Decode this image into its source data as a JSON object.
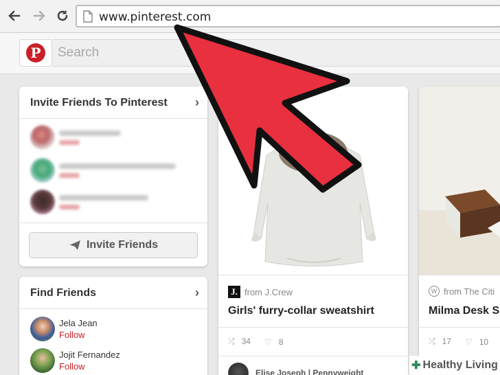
{
  "browser": {
    "url": "www.pinterest.com",
    "back_icon": "arrow-left-icon",
    "forward_icon": "arrow-right-icon",
    "reload_icon": "reload-icon"
  },
  "header": {
    "logo": "P",
    "search_placeholder": "Search"
  },
  "invite_card": {
    "title": "Invite Friends To Pinterest",
    "button_label": "Invite Friends"
  },
  "find_friends": {
    "title": "Find Friends",
    "friends": [
      {
        "name": "Jela Jean",
        "follow": "Follow"
      },
      {
        "name": "Jojit Fernandez",
        "follow": "Follow"
      }
    ]
  },
  "pins": [
    {
      "source_logo": "J.",
      "source": "from J.Crew",
      "title": "Girls' furry-collar sweatshirt",
      "repins": "34",
      "likes": "8",
      "pinner": "Elise Joseph | Pennyweight"
    },
    {
      "source": "from The Citi",
      "title": "Milma Desk S",
      "repins": "17",
      "likes": "10"
    }
  ],
  "watermark": "Healthy Living",
  "colors": {
    "pinterest_red": "#cb2027",
    "arrow_red": "#e8303f"
  }
}
